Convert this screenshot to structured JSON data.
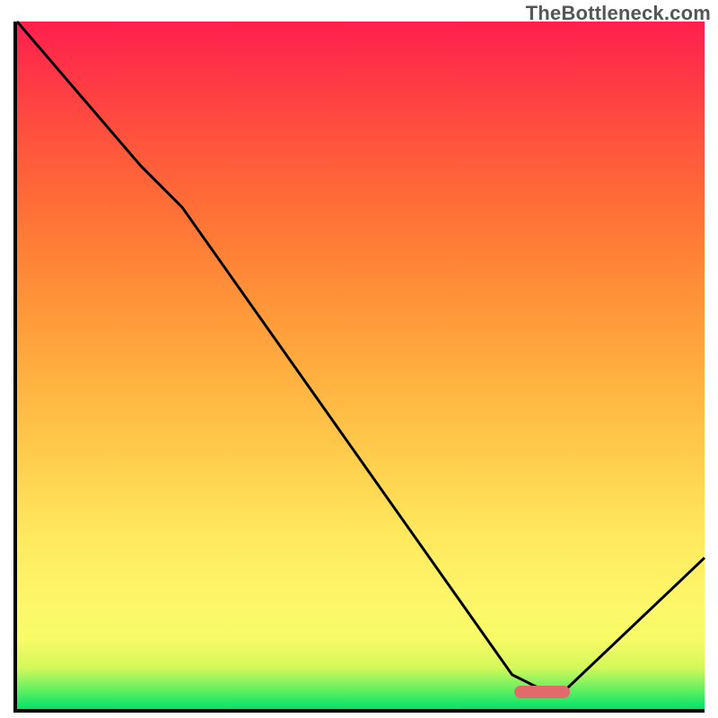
{
  "watermark": "TheBottleneck.com",
  "colors": {
    "curve": "#000000",
    "marker": "#e26a6a",
    "axis": "#000000"
  },
  "chart_data": {
    "type": "line",
    "title": "",
    "xlabel": "",
    "ylabel": "",
    "xlim": [
      0,
      100
    ],
    "ylim": [
      0,
      100
    ],
    "x": [
      0,
      18,
      24,
      72,
      76,
      80,
      100
    ],
    "values": [
      100,
      79,
      73,
      5,
      3,
      3,
      22
    ],
    "marker": {
      "x_center": 76,
      "y": 3,
      "width": 8
    },
    "legend": false,
    "grid": false
  }
}
